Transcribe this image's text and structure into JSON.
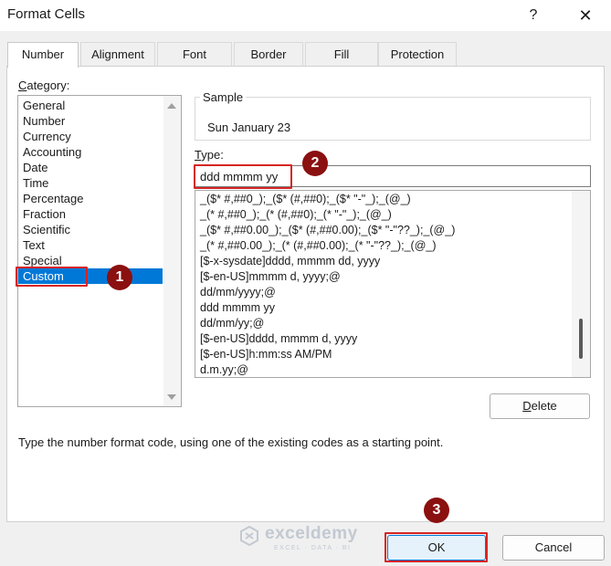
{
  "window": {
    "title": "Format Cells",
    "help_glyph": "?",
    "close_glyph": "✕"
  },
  "tabs": [
    {
      "label": "Number",
      "active": true
    },
    {
      "label": "Alignment",
      "active": false
    },
    {
      "label": "Font",
      "active": false
    },
    {
      "label": "Border",
      "active": false
    },
    {
      "label": "Fill",
      "active": false
    },
    {
      "label": "Protection",
      "active": false
    }
  ],
  "category": {
    "label_first": "C",
    "label_rest": "ategory:",
    "items": [
      "General",
      "Number",
      "Currency",
      "Accounting",
      "Date",
      "Time",
      "Percentage",
      "Fraction",
      "Scientific",
      "Text",
      "Special",
      "Custom"
    ],
    "selected": "Custom"
  },
  "sample": {
    "legend": "Sample",
    "value": "Sun January 23"
  },
  "type": {
    "label_first": "T",
    "label_rest": "ype:",
    "value": "ddd mmmm yy"
  },
  "format_list": [
    "_($* #,##0_);_($* (#,##0);_($* \"-\"_);_(@_)",
    "_(* #,##0_);_(* (#,##0);_(* \"-\"_);_(@_)",
    "_($* #,##0.00_);_($* (#,##0.00);_($* \"-\"??_);_(@_)",
    "_(* #,##0.00_);_(* (#,##0.00);_(* \"-\"??_);_(@_)",
    "[$-x-sysdate]dddd, mmmm dd, yyyy",
    "[$-en-US]mmmm d, yyyy;@",
    "dd/mm/yyyy;@",
    "ddd mmmm yy",
    "dd/mm/yy;@",
    "[$-en-US]dddd, mmmm d, yyyy",
    "[$-en-US]h:mm:ss AM/PM",
    "d.m.yy;@"
  ],
  "buttons": {
    "delete_first": "D",
    "delete_rest": "elete",
    "ok": "OK",
    "cancel": "Cancel"
  },
  "hint": "Type the number format code, using one of the existing codes as a starting point.",
  "callouts": {
    "one": "1",
    "two": "2",
    "three": "3"
  },
  "watermark": {
    "brand": "exceldemy",
    "tagline": "EXCEL · DATA · BI"
  },
  "colors": {
    "selection": "#0078d7",
    "callout_border": "#d62424",
    "callout_badge": "#8b1010"
  }
}
